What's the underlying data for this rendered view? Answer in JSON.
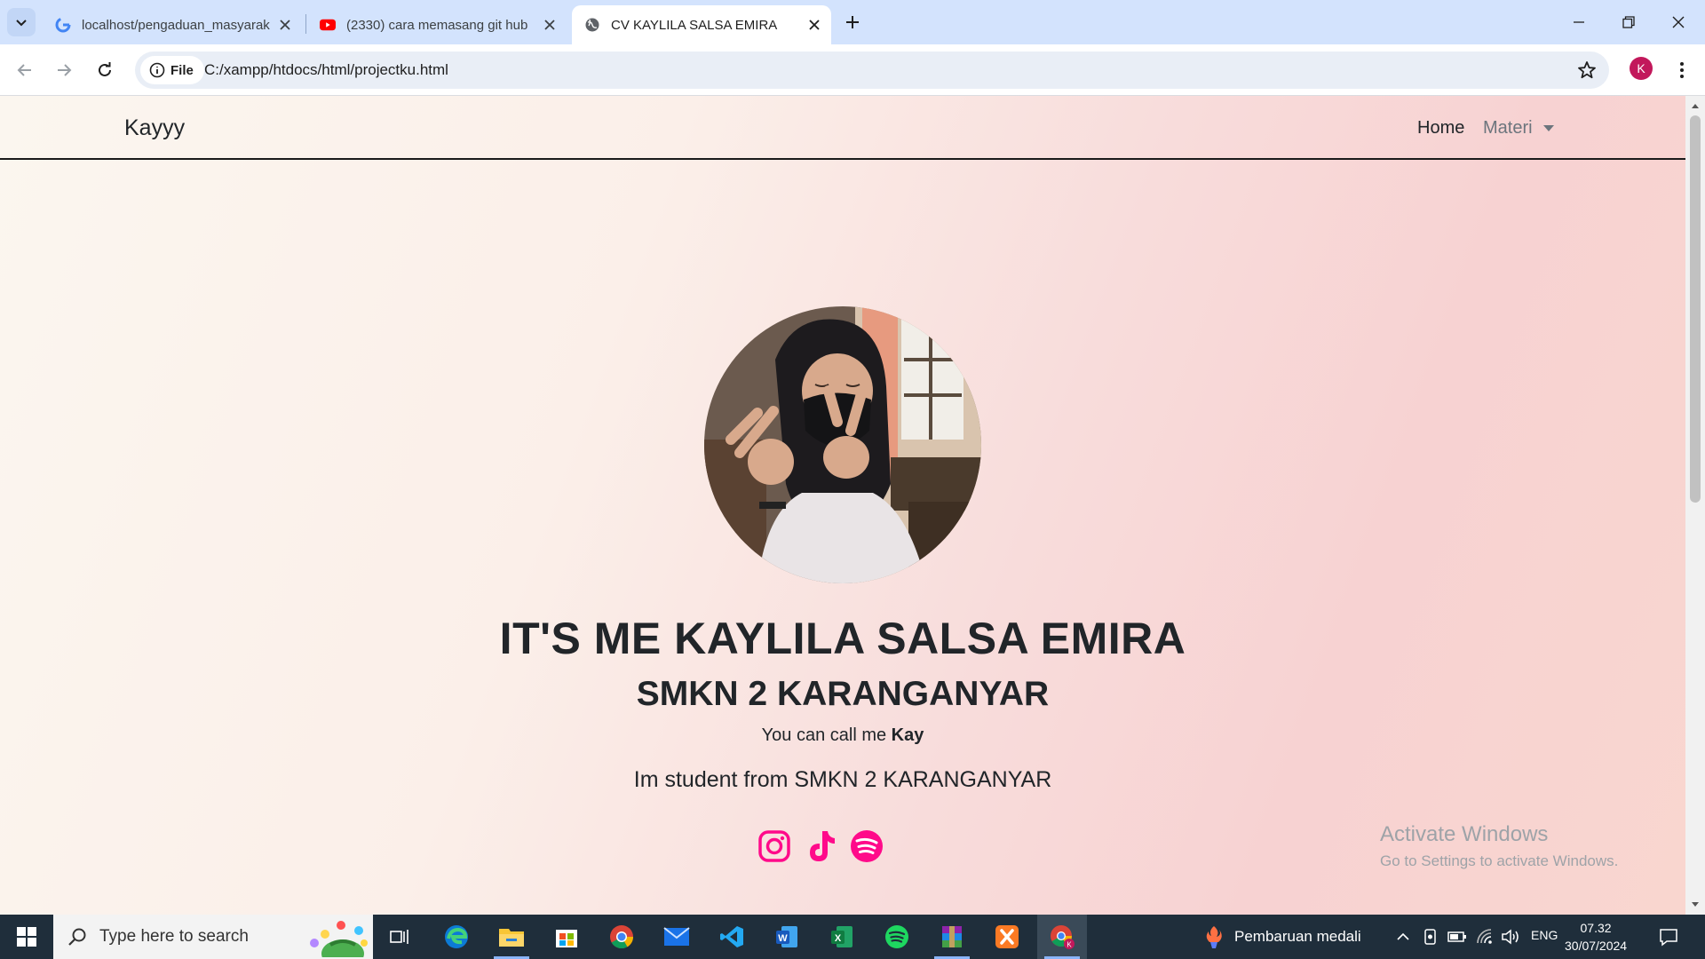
{
  "browser": {
    "tabs": [
      {
        "title": "localhost/pengaduan_masyarak",
        "icon": "google-icon"
      },
      {
        "title": "(2330) cara memasang git hub",
        "icon": "youtube-icon"
      },
      {
        "title": "CV KAYLILA SALSA EMIRA",
        "icon": "globe-icon",
        "active": true
      }
    ],
    "address": {
      "chip": "File",
      "url": "C:/xampp/htdocs/html/projectku.html"
    },
    "profile_initial": "K"
  },
  "site": {
    "brand": "Kayyy",
    "nav": {
      "home": "Home",
      "materi": "Materi"
    },
    "title": "IT'S ME KAYLILA SALSA EMIRA",
    "school": "SMKN 2 KARANGANYAR",
    "call_prefix": "You can call me ",
    "call_name": "Kay",
    "student": "Im student from SMKN 2 KARANGANYAR",
    "socials": [
      "instagram-icon",
      "tiktok-icon",
      "spotify-icon"
    ],
    "accent_color": "#ff0a8a"
  },
  "watermark": {
    "line1": "Activate Windows",
    "line2": "Go to Settings to activate Windows."
  },
  "taskbar": {
    "search_placeholder": "Type here to search",
    "apps": [
      "task-view-icon",
      "edge-icon",
      "file-explorer-icon",
      "store-icon",
      "chrome-icon",
      "mail-icon",
      "vscode-icon",
      "word-icon",
      "excel-icon",
      "spotify-icon",
      "winrar-icon",
      "xampp-icon",
      "chrome-profile-icon"
    ],
    "news": "Pembaruan medali",
    "lang": "ENG",
    "time": "07.32",
    "date": "30/07/2024"
  }
}
